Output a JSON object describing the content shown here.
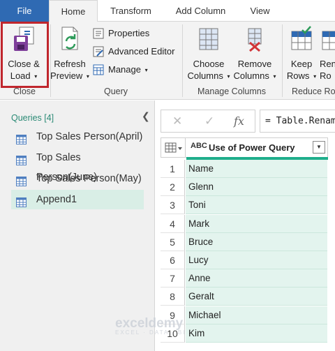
{
  "tabs": [
    {
      "label": "File"
    },
    {
      "label": "Home"
    },
    {
      "label": "Transform"
    },
    {
      "label": "Add Column"
    },
    {
      "label": "View"
    }
  ],
  "ribbon": {
    "close_load": {
      "line1": "Close &",
      "line2": "Load",
      "caret": "▾"
    },
    "close_group": "Close",
    "refresh": {
      "line1": "Refresh",
      "line2": "Preview"
    },
    "properties": "Properties",
    "advanced_editor": "Advanced Editor",
    "manage": "Manage",
    "query_group": "Query",
    "choose_columns": {
      "line1": "Choose",
      "line2": "Columns"
    },
    "remove_columns": {
      "line1": "Remove",
      "line2": "Columns"
    },
    "manage_columns_group": "Manage Columns",
    "keep_rows": {
      "line1": "Keep",
      "line2": "Rows"
    },
    "remove_rows_partial": {
      "line1": "Ren",
      "line2": "Ro"
    },
    "reduce_rows_group": "Reduce Ro"
  },
  "queries": {
    "header": "Queries [4]",
    "items": [
      {
        "label": "Top Sales Person(April)"
      },
      {
        "label": "Top Sales Person(June)"
      },
      {
        "label": "Top Sales Person(May)"
      },
      {
        "label": "Append1"
      }
    ]
  },
  "formula_bar": {
    "fx": "fx",
    "formula": "= Table.RenameColumns"
  },
  "grid": {
    "type_icon": "ABC",
    "column": "Use of Power Query",
    "rows": [
      {
        "num": "1",
        "value": "Name"
      },
      {
        "num": "2",
        "value": "Glenn"
      },
      {
        "num": "3",
        "value": "Toni"
      },
      {
        "num": "4",
        "value": "Mark"
      },
      {
        "num": "5",
        "value": "Bruce"
      },
      {
        "num": "6",
        "value": "Lucy"
      },
      {
        "num": "7",
        "value": "Anne"
      },
      {
        "num": "8",
        "value": "Geralt"
      },
      {
        "num": "9",
        "value": "Michael"
      },
      {
        "num": "10",
        "value": "Kim"
      }
    ]
  },
  "watermark": {
    "brand": "exceldemy",
    "tagline": "EXCEL · DATA · BI"
  },
  "colors": {
    "accent": "#2f6ab3",
    "highlight": "#c0262d",
    "teal": "#1fae8c"
  }
}
